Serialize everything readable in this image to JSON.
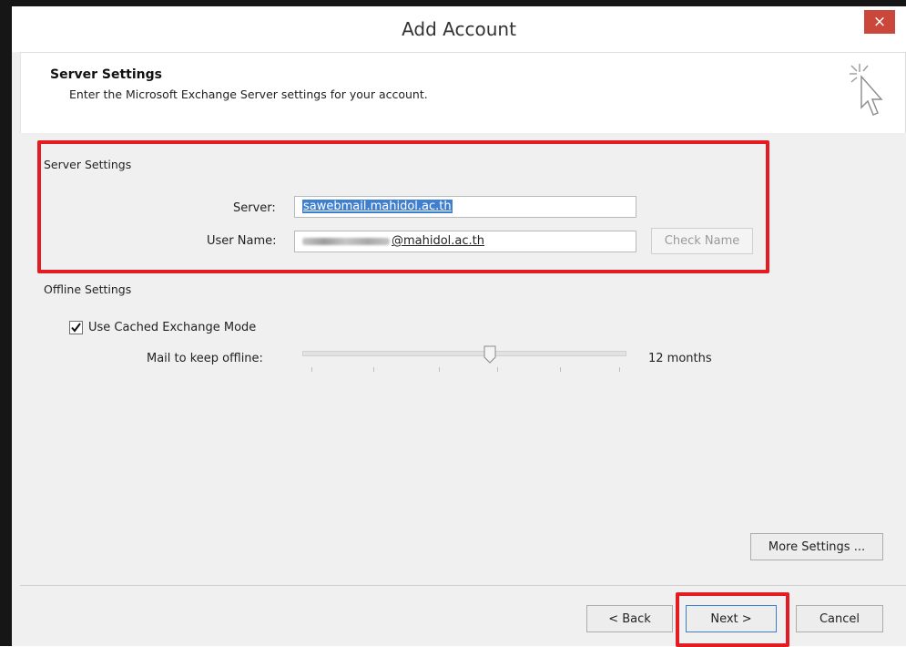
{
  "window": {
    "title": "Add Account",
    "close_icon": "close-icon",
    "close_glyph": "×"
  },
  "header": {
    "title": "Server Settings",
    "subtitle": "Enter the Microsoft Exchange Server settings for your account.",
    "icon": "wizard-cursor-icon"
  },
  "server_settings": {
    "group_label": "Server Settings",
    "server_label": "Server:",
    "server_value": "sawebmail.mahidol.ac.th",
    "username_label": "User Name:",
    "username_visible_suffix": "@mahidol.ac.th",
    "check_name_label": "Check Name"
  },
  "offline_settings": {
    "group_label": "Offline Settings",
    "cached_mode_label": "Use Cached Exchange Mode",
    "cached_mode_checked": true,
    "mail_keep_label": "Mail to keep offline:",
    "slider_value_label": "12 months",
    "slider_fraction": 0.58
  },
  "buttons": {
    "more_settings": "More Settings ...",
    "back": "< Back",
    "next": "Next >",
    "cancel": "Cancel"
  },
  "colors": {
    "highlight": "#e31b23",
    "close_button": "#c9483b",
    "selection": "#3f7fcf"
  }
}
